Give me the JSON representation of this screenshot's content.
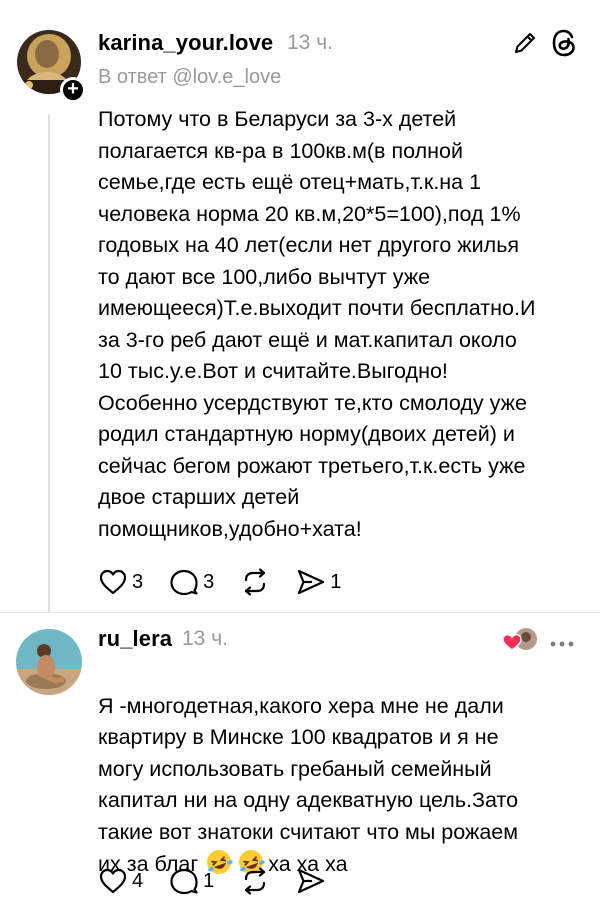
{
  "post1": {
    "username": "karina_your.love",
    "time": "13 ч.",
    "reply_to": "В ответ @lov.e_love",
    "text": "Потому что в Беларуси за 3-х детей\nполагается кв-ра в 100кв.м(в полной\nсемье,где есть ещё отец+мать,т.к.на 1\nчеловека норма 20 кв.м,20*5=100),под 1%\nгодовых на 40 лет(если нет другого жилья\nто дают все 100,либо вычтут уже\nимеющееся)Т.е.выходит почти бесплатно.И\nза 3-го реб дают ещё и мат.капитал около\n10 тыс.у.е.Вот и считайте.Выгодно!\nОсобенно усердствуют те,кто смолоду уже\nродил стандартную норму(двоих детей) и\nсейчас бегом рожают третьего,т.к.есть уже\nдвое старших детей\nпомощников,удобно+хата!",
    "likes": "3",
    "comments": "3",
    "shares": "1",
    "icons": [
      "heart-icon",
      "comment-icon",
      "repost-icon",
      "share-icon",
      "edit-icon",
      "threads-icon",
      "plus-icon"
    ]
  },
  "post2": {
    "username": "ru_lera",
    "time": "13 ч.",
    "text_main": "Я -многодетная,какого хера мне не дали\nквартиру в Минске 100 квадратов и я не\nмогу использовать гребаный семейный\nкапитал ни на одну адекватную цель.Зато\nтакие вот знатоки считают что мы рожаем\nих за благ ",
    "text_tail": "ха ха ха",
    "likes": "4",
    "comments": "1",
    "icons": [
      "heart-icon",
      "comment-icon",
      "repost-icon",
      "share-icon",
      "more-icon",
      "liked-by-author-icon",
      "laughing-emoji-icon"
    ]
  },
  "colors": {
    "text": "#000000",
    "muted": "#9a9a9a",
    "divider": "#e4e4e4",
    "heart": "#ff2d55"
  }
}
